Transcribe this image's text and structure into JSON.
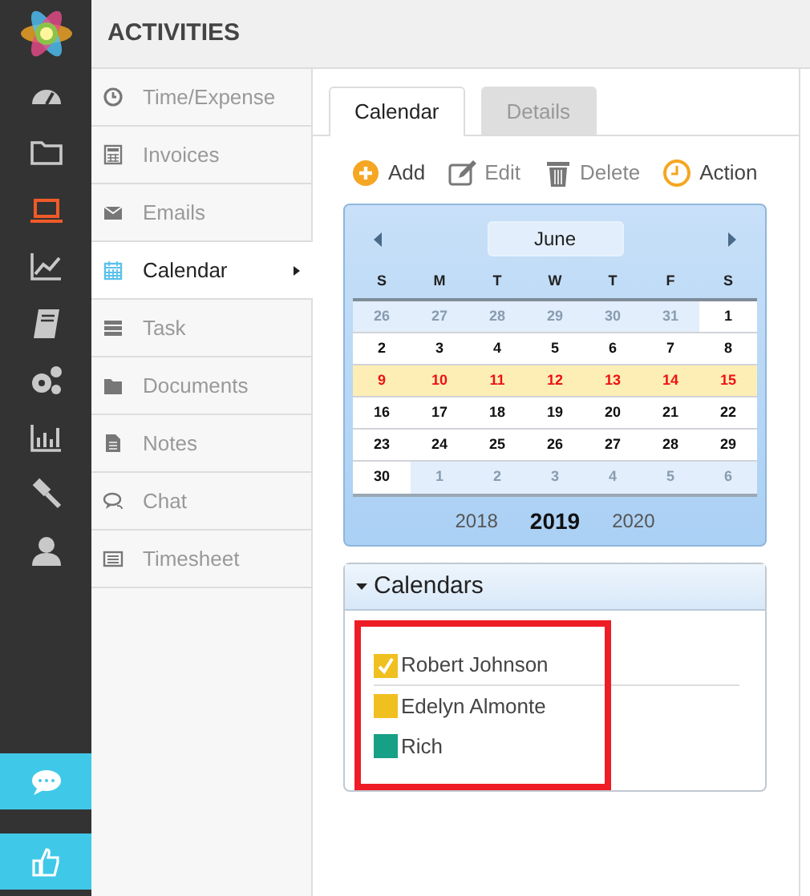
{
  "rail": {
    "items": [
      {
        "kind": "gauge",
        "selected": false
      },
      {
        "kind": "folder",
        "selected": false
      },
      {
        "kind": "laptop",
        "selected": true
      },
      {
        "kind": "chart",
        "selected": false
      },
      {
        "kind": "book",
        "selected": false
      },
      {
        "kind": "gears",
        "selected": false
      },
      {
        "kind": "bars",
        "selected": false
      },
      {
        "kind": "gavel",
        "selected": false
      },
      {
        "kind": "user",
        "selected": false
      }
    ],
    "bottom_buttons": [
      {
        "kind": "chat"
      },
      {
        "kind": "thumb"
      }
    ]
  },
  "header": {
    "title": "ACTIVITIES"
  },
  "submenu": [
    {
      "label": "Time/Expense",
      "kind": "clock",
      "selected": false
    },
    {
      "label": "Invoices",
      "kind": "calc",
      "selected": false
    },
    {
      "label": "Emails",
      "kind": "mail",
      "selected": false
    },
    {
      "label": "Calendar",
      "kind": "cal",
      "selected": true
    },
    {
      "label": "Task",
      "kind": "task",
      "selected": false
    },
    {
      "label": "Documents",
      "kind": "folder",
      "selected": false
    },
    {
      "label": "Notes",
      "kind": "note",
      "selected": false
    },
    {
      "label": "Chat",
      "kind": "chat",
      "selected": false
    },
    {
      "label": "Timesheet",
      "kind": "sheet",
      "selected": false
    }
  ],
  "tabs": [
    {
      "label": "Calendar",
      "selected": true
    },
    {
      "label": "Details",
      "selected": false
    }
  ],
  "toolbar": [
    {
      "label": "Add",
      "kind": "add"
    },
    {
      "label": "Edit",
      "kind": "edit"
    },
    {
      "label": "Delete",
      "kind": "trash"
    },
    {
      "label": "Action",
      "kind": "clock"
    }
  ],
  "calendar": {
    "month": "June",
    "weekdays": [
      "S",
      "M",
      "T",
      "W",
      "T",
      "F",
      "S"
    ],
    "weeks": [
      {
        "highlighted": false,
        "days": [
          {
            "day": "26",
            "other": true
          },
          {
            "day": "27",
            "other": true
          },
          {
            "day": "28",
            "other": true
          },
          {
            "day": "29",
            "other": true
          },
          {
            "day": "30",
            "other": true
          },
          {
            "day": "31",
            "other": true
          },
          {
            "day": "1",
            "other": false
          }
        ]
      },
      {
        "highlighted": false,
        "days": [
          {
            "day": "2",
            "other": false
          },
          {
            "day": "3",
            "other": false
          },
          {
            "day": "4",
            "other": false
          },
          {
            "day": "5",
            "other": false
          },
          {
            "day": "6",
            "other": false
          },
          {
            "day": "7",
            "other": false
          },
          {
            "day": "8",
            "other": false
          }
        ]
      },
      {
        "highlighted": true,
        "days": [
          {
            "day": "9",
            "other": false
          },
          {
            "day": "10",
            "other": false
          },
          {
            "day": "11",
            "other": false
          },
          {
            "day": "12",
            "other": false
          },
          {
            "day": "13",
            "other": false
          },
          {
            "day": "14",
            "other": false
          },
          {
            "day": "15",
            "other": false
          }
        ]
      },
      {
        "highlighted": false,
        "days": [
          {
            "day": "16",
            "other": false
          },
          {
            "day": "17",
            "other": false
          },
          {
            "day": "18",
            "other": false
          },
          {
            "day": "19",
            "other": false
          },
          {
            "day": "20",
            "other": false
          },
          {
            "day": "21",
            "other": false
          },
          {
            "day": "22",
            "other": false
          }
        ]
      },
      {
        "highlighted": false,
        "days": [
          {
            "day": "23",
            "other": false
          },
          {
            "day": "24",
            "other": false
          },
          {
            "day": "25",
            "other": false
          },
          {
            "day": "26",
            "other": false
          },
          {
            "day": "27",
            "other": false
          },
          {
            "day": "28",
            "other": false
          },
          {
            "day": "29",
            "other": false
          }
        ]
      },
      {
        "highlighted": false,
        "days": [
          {
            "day": "30",
            "other": false
          },
          {
            "day": "1",
            "other": true
          },
          {
            "day": "2",
            "other": true
          },
          {
            "day": "3",
            "other": true
          },
          {
            "day": "4",
            "other": true
          },
          {
            "day": "5",
            "other": true
          },
          {
            "day": "6",
            "other": true
          }
        ]
      }
    ],
    "years": [
      {
        "label": "2018",
        "selected": false
      },
      {
        "label": "2019",
        "selected": true
      },
      {
        "label": "2020",
        "selected": false
      }
    ]
  },
  "calendars_panel": {
    "title": "Calendars",
    "expanded": true,
    "items": [
      {
        "name": "Robert Johnson",
        "checked": true,
        "color": "#f0c020"
      },
      {
        "name": "Edelyn Almonte",
        "checked": false,
        "color": "#f0c020"
      },
      {
        "name": "Rich",
        "checked": false,
        "color": "#16a085"
      }
    ]
  }
}
